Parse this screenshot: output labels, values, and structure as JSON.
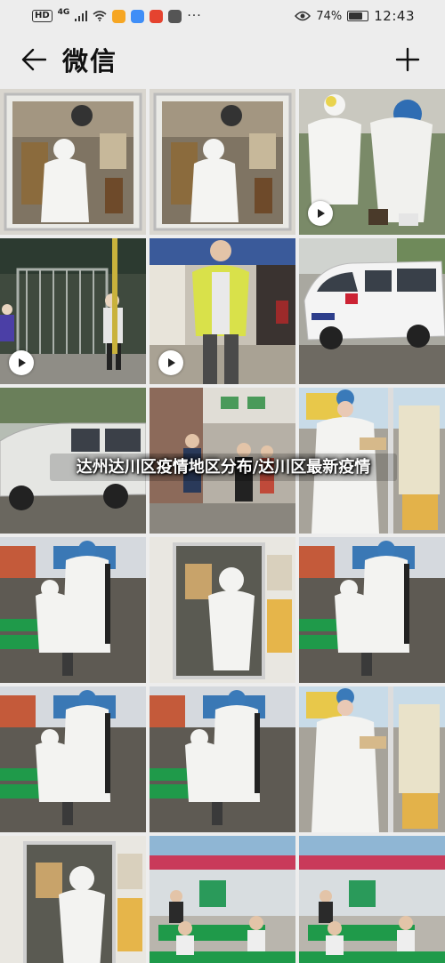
{
  "status_bar": {
    "hd": "HD",
    "network": "4G",
    "battery": "74%",
    "battery_level": 0.74,
    "time": "12:43",
    "more": "···",
    "app_icon_colors": [
      "#f6a623",
      "#3f8ef7",
      "#e5432f",
      "#f2b705"
    ]
  },
  "nav": {
    "back_icon": "back-arrow-icon",
    "title": "微信",
    "add_icon": "plus-icon"
  },
  "overlay": {
    "caption": "达州达川区疫情地区分布/达川区最新疫情"
  },
  "grid": {
    "columns": 3,
    "items": [
      {
        "scene": "room-window",
        "video": false
      },
      {
        "scene": "room-window",
        "video": false
      },
      {
        "scene": "hazmat-pair",
        "video": true
      },
      {
        "scene": "gate",
        "video": true
      },
      {
        "scene": "woman-green-jacket",
        "video": true
      },
      {
        "scene": "white-van",
        "video": false
      },
      {
        "scene": "van-street",
        "video": false
      },
      {
        "scene": "street-people",
        "video": false
      },
      {
        "scene": "hazmat-desk",
        "video": false
      },
      {
        "scene": "hazmat-classroom",
        "video": false
      },
      {
        "scene": "hazmat-doorway",
        "video": false
      },
      {
        "scene": "hazmat-classroom",
        "video": false
      },
      {
        "scene": "hazmat-classroom",
        "video": false
      },
      {
        "scene": "hazmat-classroom",
        "video": false
      },
      {
        "scene": "hazmat-desk",
        "video": false
      },
      {
        "scene": "hazmat-doorway",
        "video": false
      },
      {
        "scene": "classroom-kids",
        "video": false
      },
      {
        "scene": "classroom-kids",
        "video": false
      }
    ]
  },
  "colors": {
    "background": "#ededed",
    "hazmat": "#f2f2f0",
    "classroom_green": "#1f9a4a",
    "floor": "#5a564f"
  }
}
